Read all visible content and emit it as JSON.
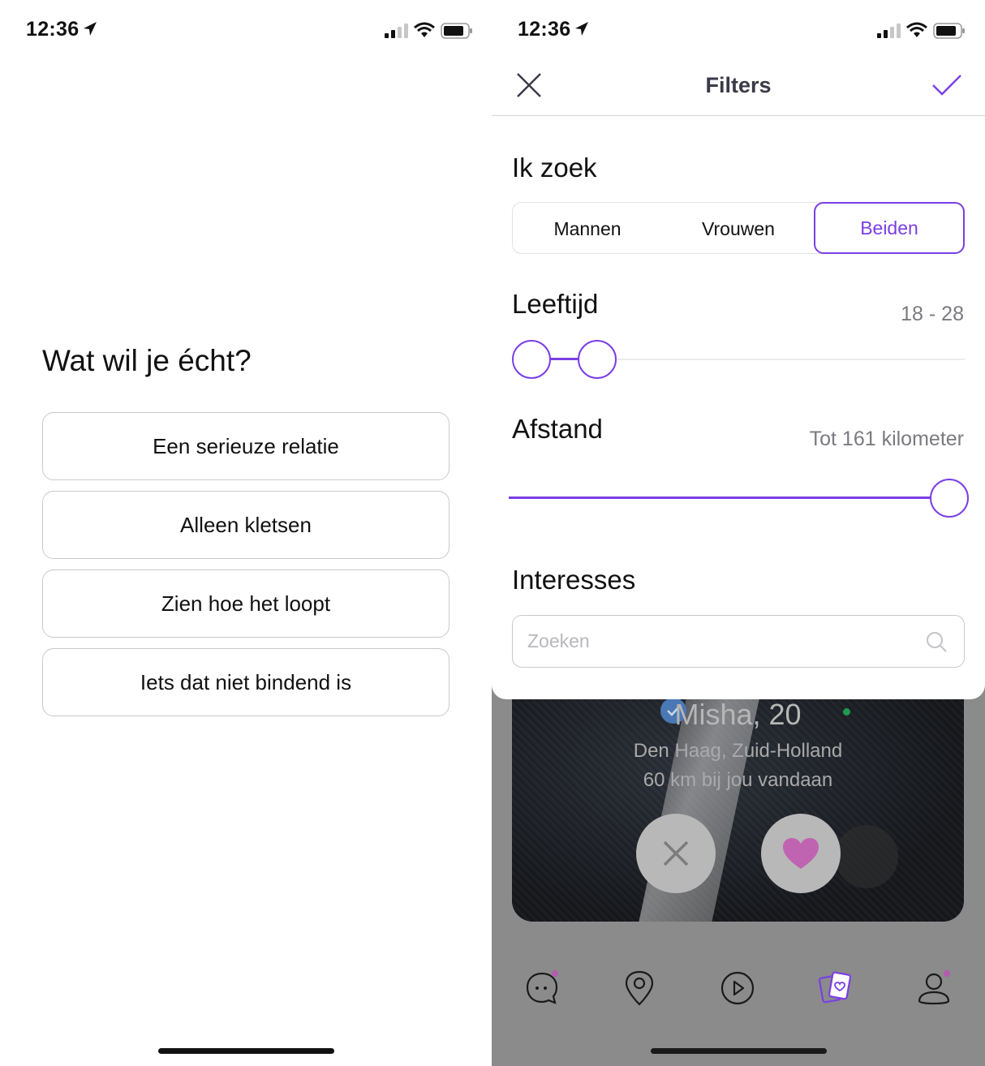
{
  "left": {
    "status": {
      "time": "12:36"
    },
    "question": "Wat wil je écht?",
    "options": [
      "Een serieuze relatie",
      "Alleen kletsen",
      "Zien hoe het loopt",
      "Iets dat niet bindend is"
    ]
  },
  "right": {
    "status": {
      "time": "12:36"
    },
    "nav": {
      "title": "Filters"
    },
    "looking_for": {
      "title": "Ik zoek",
      "options": [
        "Mannen",
        "Vrouwen",
        "Beiden"
      ],
      "selected": "Beiden"
    },
    "age": {
      "title": "Leeftijd",
      "value": "18 - 28",
      "min": 18,
      "max": 28
    },
    "distance": {
      "title": "Afstand",
      "value": "Tot 161 kilometer",
      "km": 161
    },
    "interests": {
      "title": "Interesses",
      "placeholder": "Zoeken"
    },
    "card": {
      "name": "Misha, 20",
      "location": "Den Haag, Zuid-Holland",
      "distance": "60 km bij jou vandaan"
    },
    "tabs": [
      "chat-icon",
      "map-pin-icon",
      "play-icon",
      "cards-icon",
      "profile-icon"
    ],
    "colors": {
      "accent": "#7b3fe4",
      "like": "#d66fc2"
    }
  }
}
